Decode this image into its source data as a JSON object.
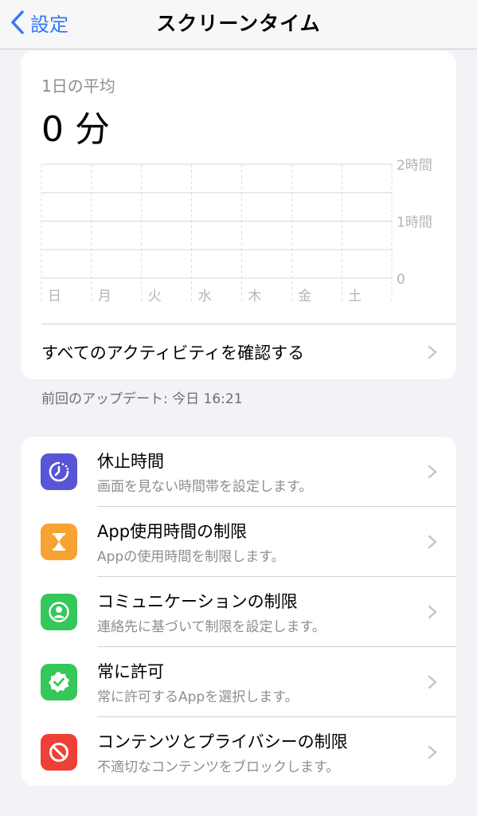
{
  "nav": {
    "back_label": "設定",
    "title": "スクリーンタイム"
  },
  "summary": {
    "avg_label": "1日の平均",
    "avg_value": "0 分",
    "see_all_label": "すべてのアクティビティを確認する",
    "updated_text": "前回のアップデート: 今日 16:21"
  },
  "chart_data": {
    "type": "bar",
    "categories": [
      "日",
      "月",
      "火",
      "水",
      "木",
      "金",
      "土"
    ],
    "values": [
      0,
      0,
      0,
      0,
      0,
      0,
      0
    ],
    "y_tick_labels": [
      "2時間",
      "1時間",
      "0"
    ],
    "ylim": [
      0,
      2
    ],
    "grid": true
  },
  "items": [
    {
      "title": "休止時間",
      "sub": "画面を見ない時間帯を設定します。",
      "icon": "downtime-icon",
      "color": "#5856d6"
    },
    {
      "title": "App使用時間の制限",
      "sub": "Appの使用時間を制限します。",
      "icon": "hourglass-icon",
      "color": "#f7a233"
    },
    {
      "title": "コミュニケーションの制限",
      "sub": "連絡先に基づいて制限を設定します。",
      "icon": "person-circle-icon",
      "color": "#34c759"
    },
    {
      "title": "常に許可",
      "sub": "常に許可するAppを選択します。",
      "icon": "checkmark-seal-icon",
      "color": "#34c759"
    },
    {
      "title": "コンテンツとプライバシーの制限",
      "sub": "不適切なコンテンツをブロックします。",
      "icon": "prohibited-icon",
      "color": "#ef4035"
    }
  ],
  "colors": {
    "accent": "#3478f6",
    "background": "#f2f2f7",
    "chevron": "#c4c4c7"
  }
}
